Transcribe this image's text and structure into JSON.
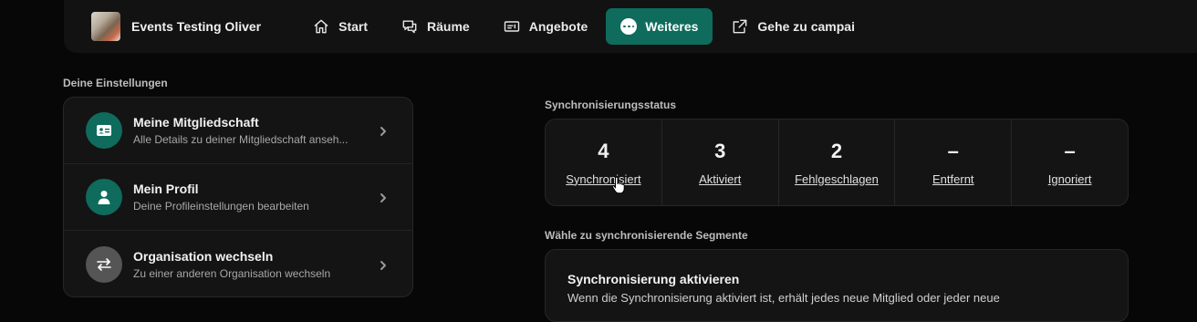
{
  "topbar": {
    "org_name": "Events Testing Oliver",
    "nav": [
      {
        "label": "Start",
        "icon": "home-icon",
        "active": false
      },
      {
        "label": "Räume",
        "icon": "chat-icon",
        "active": false
      },
      {
        "label": "Angebote",
        "icon": "ticket-icon",
        "active": false
      },
      {
        "label": "Weiteres",
        "icon": "more-dots-icon",
        "active": true
      },
      {
        "label": "Gehe zu campai",
        "icon": "external-link-icon",
        "active": false
      }
    ]
  },
  "settings": {
    "heading": "Deine Einstellungen",
    "items": [
      {
        "title": "Meine Mitgliedschaft",
        "desc": "Alle Details zu deiner Mitgliedschaft anseh...",
        "icon": "id-card-icon"
      },
      {
        "title": "Mein Profil",
        "desc": "Deine Profileinstellungen bearbeiten",
        "icon": "user-icon"
      },
      {
        "title": "Organisation wechseln",
        "desc": "Zu einer anderen Organisation wechseln",
        "icon": "switch-arrows-icon"
      }
    ]
  },
  "sync_status": {
    "heading": "Synchronisierungsstatus",
    "stats": [
      {
        "value": "4",
        "label": "Synchronisiert"
      },
      {
        "value": "3",
        "label": "Aktiviert"
      },
      {
        "value": "2",
        "label": "Fehlgeschlagen"
      },
      {
        "value": "–",
        "label": "Entfernt"
      },
      {
        "value": "–",
        "label": "Ignoriert"
      }
    ]
  },
  "segments": {
    "heading": "Wähle zu synchronisierende Segmente",
    "card_title": "Synchronisierung aktivieren",
    "card_desc": "Wenn die Synchronisierung aktiviert ist, erhält jedes neue Mitglied oder jeder neue"
  },
  "colors": {
    "accent": "#0f6b5c",
    "background": "#070707",
    "card": "#141414"
  }
}
